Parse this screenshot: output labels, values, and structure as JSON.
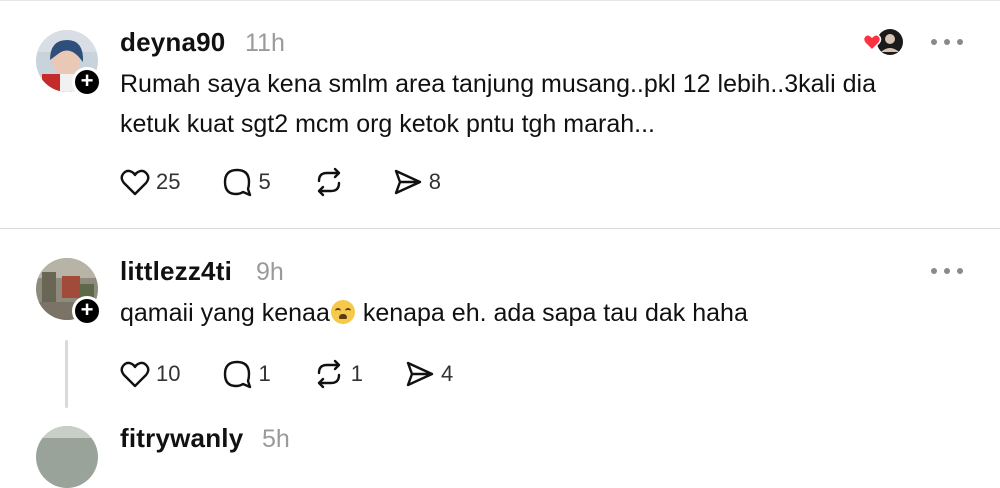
{
  "posts": [
    {
      "username": "deyna90",
      "time": "11h",
      "text_lines": [
        "Rumah saya kena smlm area tanjung musang..pkl 12 lebih..3kali dia",
        "ketuk kuat sgt2 mcm org ketok pntu tgh marah..."
      ],
      "likes": "25",
      "comments": "5",
      "reposts": "",
      "shares": "8"
    },
    {
      "username": "littlezz4ti",
      "time": "9h",
      "text_before": "qamaii yang kenaa",
      "text_after": " kenapa eh. ada sapa tau dak haha",
      "likes": "10",
      "comments": "1",
      "reposts": "1",
      "shares": "4"
    },
    {
      "username": "fitrywanly",
      "time": "5h"
    }
  ],
  "icons": [
    "heart-icon",
    "comment-icon",
    "repost-icon",
    "share-icon",
    "more-icon",
    "plus-icon"
  ]
}
